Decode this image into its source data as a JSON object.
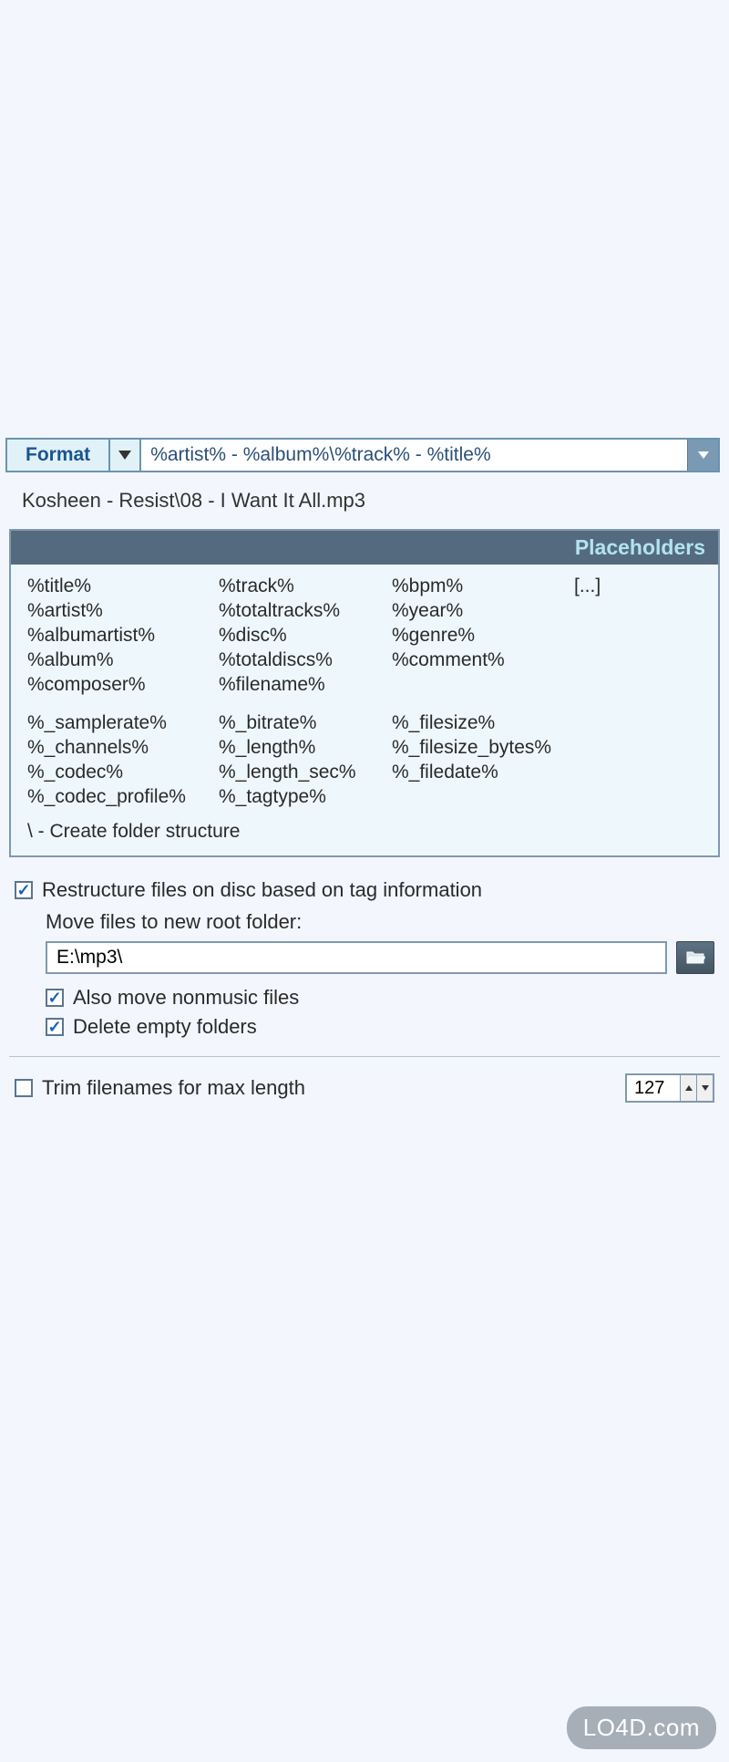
{
  "format": {
    "label": "Format",
    "value": "%artist% - %album%\\%track% - %title%"
  },
  "preview": "Kosheen - Resist\\08 - I Want It All.mp3",
  "placeholders": {
    "header": "Placeholders",
    "group1": {
      "col1": [
        "%title%",
        "%artist%",
        "%albumartist%",
        "%album%",
        "%composer%"
      ],
      "col2": [
        "%track%",
        "%totaltracks%",
        "%disc%",
        "%totaldiscs%",
        "%filename%"
      ],
      "col3": [
        "%bpm%",
        "%year%",
        "%genre%",
        "%comment%"
      ],
      "more": "[...]"
    },
    "group2": {
      "col1": [
        "%_samplerate%",
        "%_channels%",
        "%_codec%",
        "%_codec_profile%"
      ],
      "col2": [
        "%_bitrate%",
        "%_length%",
        "%_length_sec%",
        "%_tagtype%"
      ],
      "col3": [
        "%_filesize%",
        "%_filesize_bytes%",
        "%_filedate%"
      ]
    },
    "folder_note": "\\ - Create folder structure"
  },
  "restructure": {
    "checkbox_label": "Restructure files on disc based on tag information",
    "move_label": "Move files to new root folder:",
    "path": "E:\\mp3\\",
    "nonmusic_label": "Also move nonmusic files",
    "delete_empty_label": "Delete empty folders"
  },
  "trim": {
    "label": "Trim filenames for max length",
    "value": "127"
  },
  "watermark": "LO4D.com"
}
